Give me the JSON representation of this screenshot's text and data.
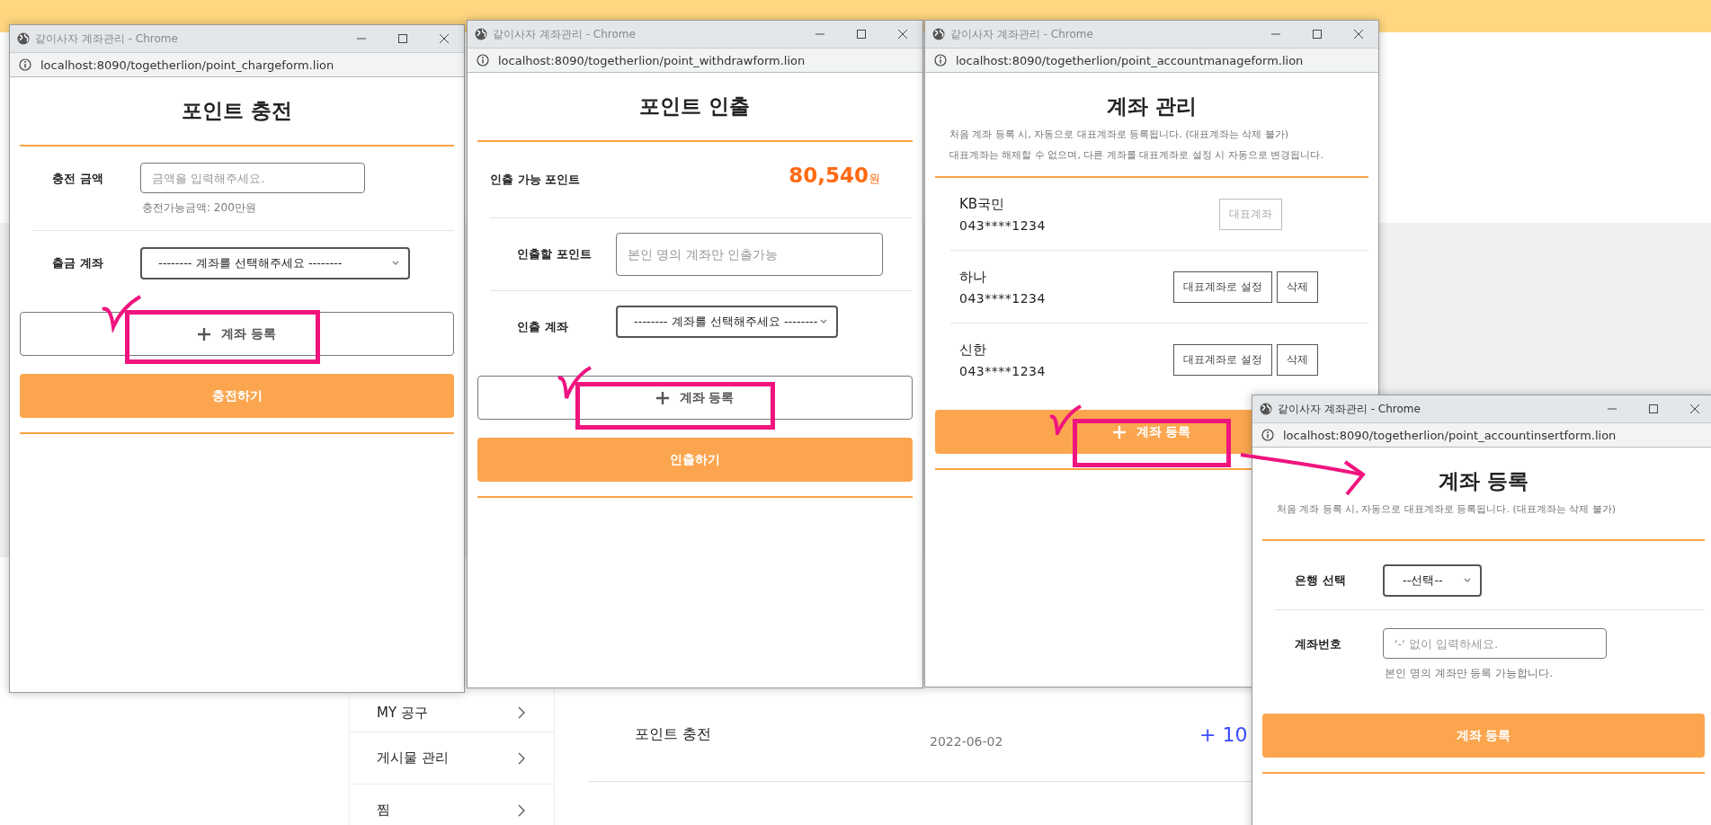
{
  "background_page": {
    "sidebar": [
      {
        "label": "MY 공구"
      },
      {
        "label": "게시물 관리"
      },
      {
        "label": "찜"
      }
    ],
    "history": [
      {
        "title": "포인트 충전",
        "date": "2022-06-02",
        "amount": "+ 10"
      }
    ]
  },
  "windows": [
    {
      "title": "같이사자 계좌관리 - Chrome",
      "active": false,
      "url": "localhost:8090/togetherlion/point_chargeform.lion",
      "heading": "포인트 충전",
      "fields": [
        {
          "kind": "input",
          "label": "충전 금액",
          "placeholder": "금액을 입력해주세요.",
          "hint": "충전가능금액: 200만원"
        },
        {
          "kind": "select",
          "label": "출금 계좌",
          "value": "-------- 계좌를 선택해주세요 --------"
        }
      ],
      "actions": [
        {
          "kind": "outline",
          "plus": true,
          "label": "계좌 등록"
        },
        {
          "kind": "solid",
          "plus": false,
          "label": "충전하기"
        }
      ]
    },
    {
      "title": "같이사자 계좌관리 - Chrome",
      "active": false,
      "url": "localhost:8090/togetherlion/point_withdrawform.lion",
      "heading": "포인트 인출",
      "fields": [
        {
          "kind": "amount",
          "label": "인출 가능 포인트",
          "value": "80,540",
          "unit": "원"
        },
        {
          "kind": "input",
          "label": "인출할 포인트",
          "placeholder": "본인 명의 계좌만 인출가능"
        },
        {
          "kind": "select",
          "label": "인출 계좌",
          "value": "-------- 계좌를 선택해주세요 --------"
        }
      ],
      "actions": [
        {
          "kind": "outline",
          "plus": true,
          "label": "계좌 등록"
        },
        {
          "kind": "solid",
          "plus": false,
          "label": "인출하기"
        }
      ]
    },
    {
      "title": "같이사자 계좌관리 - Chrome",
      "active": false,
      "url": "localhost:8090/togetherlion/point_accountmanageform.lion",
      "heading": "계좌 관리",
      "notes": [
        "처음 계좌 등록 시, 자동으로 대표계좌로 등록됩니다. (대표계좌는 삭제 불가)",
        "대표계좌는 해제할 수 없으며, 다른 계좌를 대표계좌로 설정 시 자동으로 변경됩니다."
      ],
      "accounts": [
        {
          "bank": "KB국민",
          "number": "043****1234",
          "buttons": [
            {
              "label": "대표계좌",
              "disabled": true
            }
          ]
        },
        {
          "bank": "하나",
          "number": "043****1234",
          "buttons": [
            {
              "label": "대표계좌로 설정",
              "disabled": false
            },
            {
              "label": "삭제",
              "disabled": false
            }
          ]
        },
        {
          "bank": "신한",
          "number": "043****1234",
          "buttons": [
            {
              "label": "대표계좌로 설정",
              "disabled": false
            },
            {
              "label": "삭제",
              "disabled": false
            }
          ]
        }
      ],
      "actions": [
        {
          "kind": "solid",
          "plus": true,
          "label": "계좌 등록"
        }
      ]
    },
    {
      "title": "같이사자 계좌관리 - Chrome",
      "active": true,
      "url": "localhost:8090/togetherlion/point_accountinsertform.lion",
      "heading": "계좌 등록",
      "notes": [
        "처음 계좌 등록 시, 자동으로 대표계좌로 등록됩니다. (대표계좌는 삭제 불가)"
      ],
      "fields": [
        {
          "kind": "select",
          "label": "은행 선택",
          "value": "--선택--"
        },
        {
          "kind": "input",
          "label": "계좌번호",
          "placeholder": "'-' 없이 입력하세요.",
          "hint": "본인 명의 계좌만 등록 가능합니다."
        }
      ],
      "actions": [
        {
          "kind": "solid",
          "plus": false,
          "label": "계좌 등록"
        }
      ]
    }
  ]
}
